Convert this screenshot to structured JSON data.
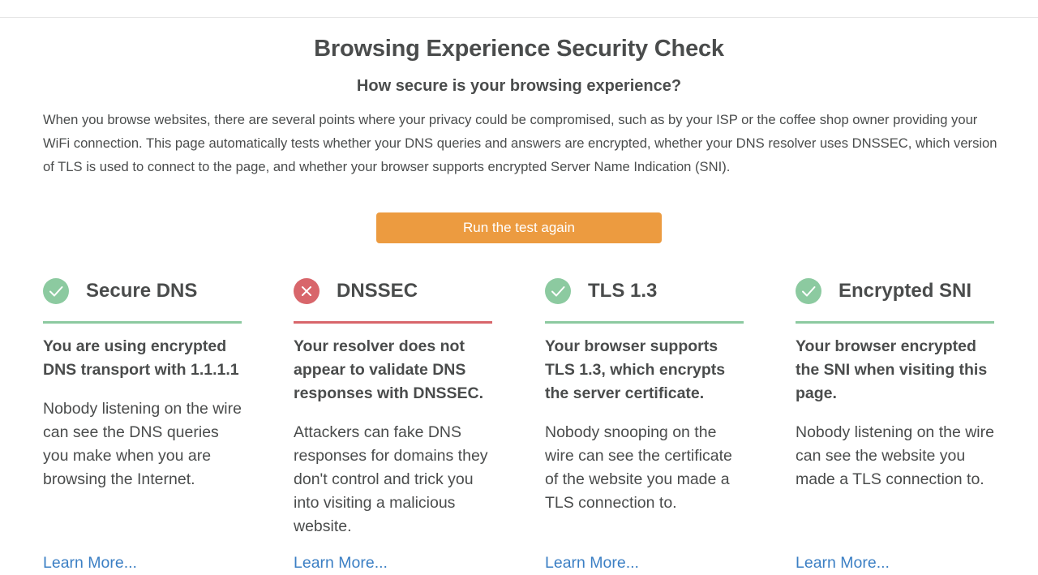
{
  "page": {
    "title": "Browsing Experience Security Check",
    "subtitle": "How secure is your browsing experience?",
    "intro": "When you browse websites, there are several points where your privacy could be compromised, such as by your ISP or the coffee shop owner providing your WiFi connection. This page automatically tests whether your DNS queries and answers are encrypted, whether your DNS resolver uses DNSSEC, which version of TLS is used to connect to the page, and whether your browser supports encrypted Server Name Indication (SNI).",
    "run_button_label": "Run the test again"
  },
  "colors": {
    "pass": "#8ccaa0",
    "fail": "#d8666b",
    "button": "#ec9b40",
    "link": "#3b7fc4"
  },
  "cards": [
    {
      "status": "pass",
      "icon": "check-icon",
      "title": "Secure DNS",
      "summary": "You are using encrypted DNS transport with 1.1.1.1",
      "detail": "Nobody listening on the wire can see the DNS queries you make when you are browsing the Internet.",
      "link_label": "Learn More..."
    },
    {
      "status": "fail",
      "icon": "cross-icon",
      "title": "DNSSEC",
      "summary": "Your resolver does not appear to validate DNS responses with DNSSEC.",
      "detail": "Attackers can fake DNS responses for domains they don't control and trick you into visiting a malicious website.",
      "link_label": "Learn More..."
    },
    {
      "status": "pass",
      "icon": "check-icon",
      "title": "TLS 1.3",
      "summary": "Your browser supports TLS 1.3, which encrypts the server certificate.",
      "detail": "Nobody snooping on the wire can see the certificate of the website you made a TLS connection to.",
      "link_label": "Learn More..."
    },
    {
      "status": "pass",
      "icon": "check-icon",
      "title": "Encrypted SNI",
      "summary": "Your browser encrypted the SNI when visiting this page.",
      "detail": "Nobody listening on the wire can see the website you made a TLS connection to.",
      "link_label": "Learn More..."
    }
  ]
}
